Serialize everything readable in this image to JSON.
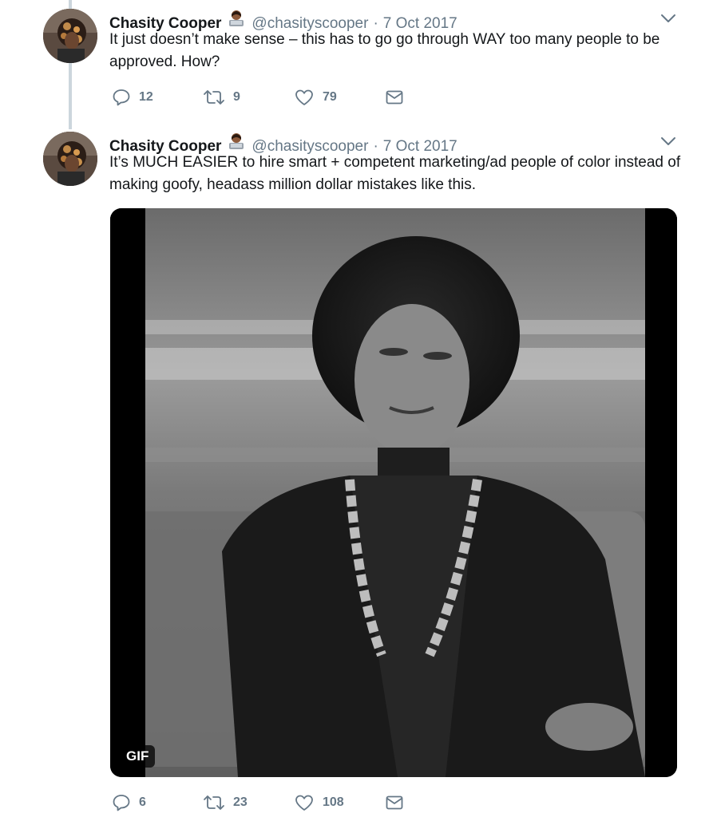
{
  "tweets": [
    {
      "name": "Chasity Cooper",
      "handle": "@chasityscooper",
      "separator": "·",
      "date": "7 Oct 2017",
      "text": "It just doesn’t make sense – this has to go go through WAY too many people to be approved. How?",
      "replies": "12",
      "retweets": "9",
      "likes": "79"
    },
    {
      "name": "Chasity Cooper",
      "handle": "@chasityscooper",
      "separator": "·",
      "date": "7 Oct 2017",
      "text": "It’s MUCH EASIER to hire smart + competent marketing/ad people of color instead of making goofy, headass million dollar mistakes like this.",
      "media_badge": "GIF",
      "replies": "6",
      "retweets": "23",
      "likes": "108"
    }
  ],
  "icons": {
    "reply": "reply-icon",
    "retweet": "retweet-icon",
    "like": "heart-icon",
    "dm": "envelope-icon",
    "caret": "chevron-down-icon"
  },
  "colors": {
    "text": "#14171a",
    "muted": "#657786",
    "thread_line": "#ccd6dd"
  }
}
